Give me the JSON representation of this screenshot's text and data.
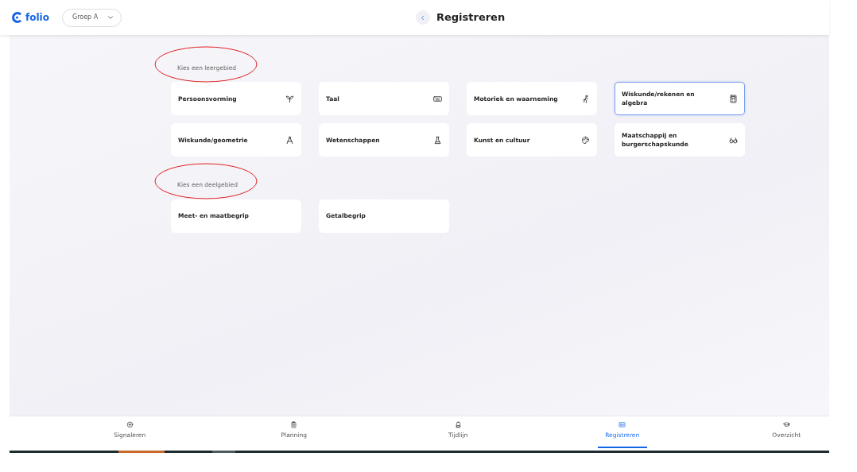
{
  "header": {
    "logo": "folio",
    "group_select": {
      "value": "Groep A"
    },
    "title": "Registreren"
  },
  "sections": [
    {
      "heading": "Kies een leergebied",
      "cards": [
        {
          "label": "Persoonsvorming",
          "selected": false
        },
        {
          "label": "Taal",
          "selected": false
        },
        {
          "label": "Motoriek en waarneming",
          "selected": false
        },
        {
          "label": "Wiskunde/rekenen en algebra",
          "selected": true
        },
        {
          "label": "Wiskunde/geometrie",
          "selected": false
        },
        {
          "label": "Wetenschappen",
          "selected": false
        },
        {
          "label": "Kunst en cultuur",
          "selected": false
        },
        {
          "label": "Maatschappij en burgerschapskunde",
          "selected": false
        }
      ]
    },
    {
      "heading": "Kies een deelgebied",
      "cards": [
        {
          "label": "Meet- en maatbegrip",
          "selected": false
        },
        {
          "label": "Getalbegrip",
          "selected": false
        }
      ]
    }
  ],
  "bottom_nav": [
    {
      "label": "Signaleren",
      "selected": false
    },
    {
      "label": "Planning",
      "selected": false
    },
    {
      "label": "Tijdlijn",
      "selected": false
    },
    {
      "label": "Registreren",
      "selected": true
    },
    {
      "label": "Overzicht",
      "selected": false
    }
  ]
}
